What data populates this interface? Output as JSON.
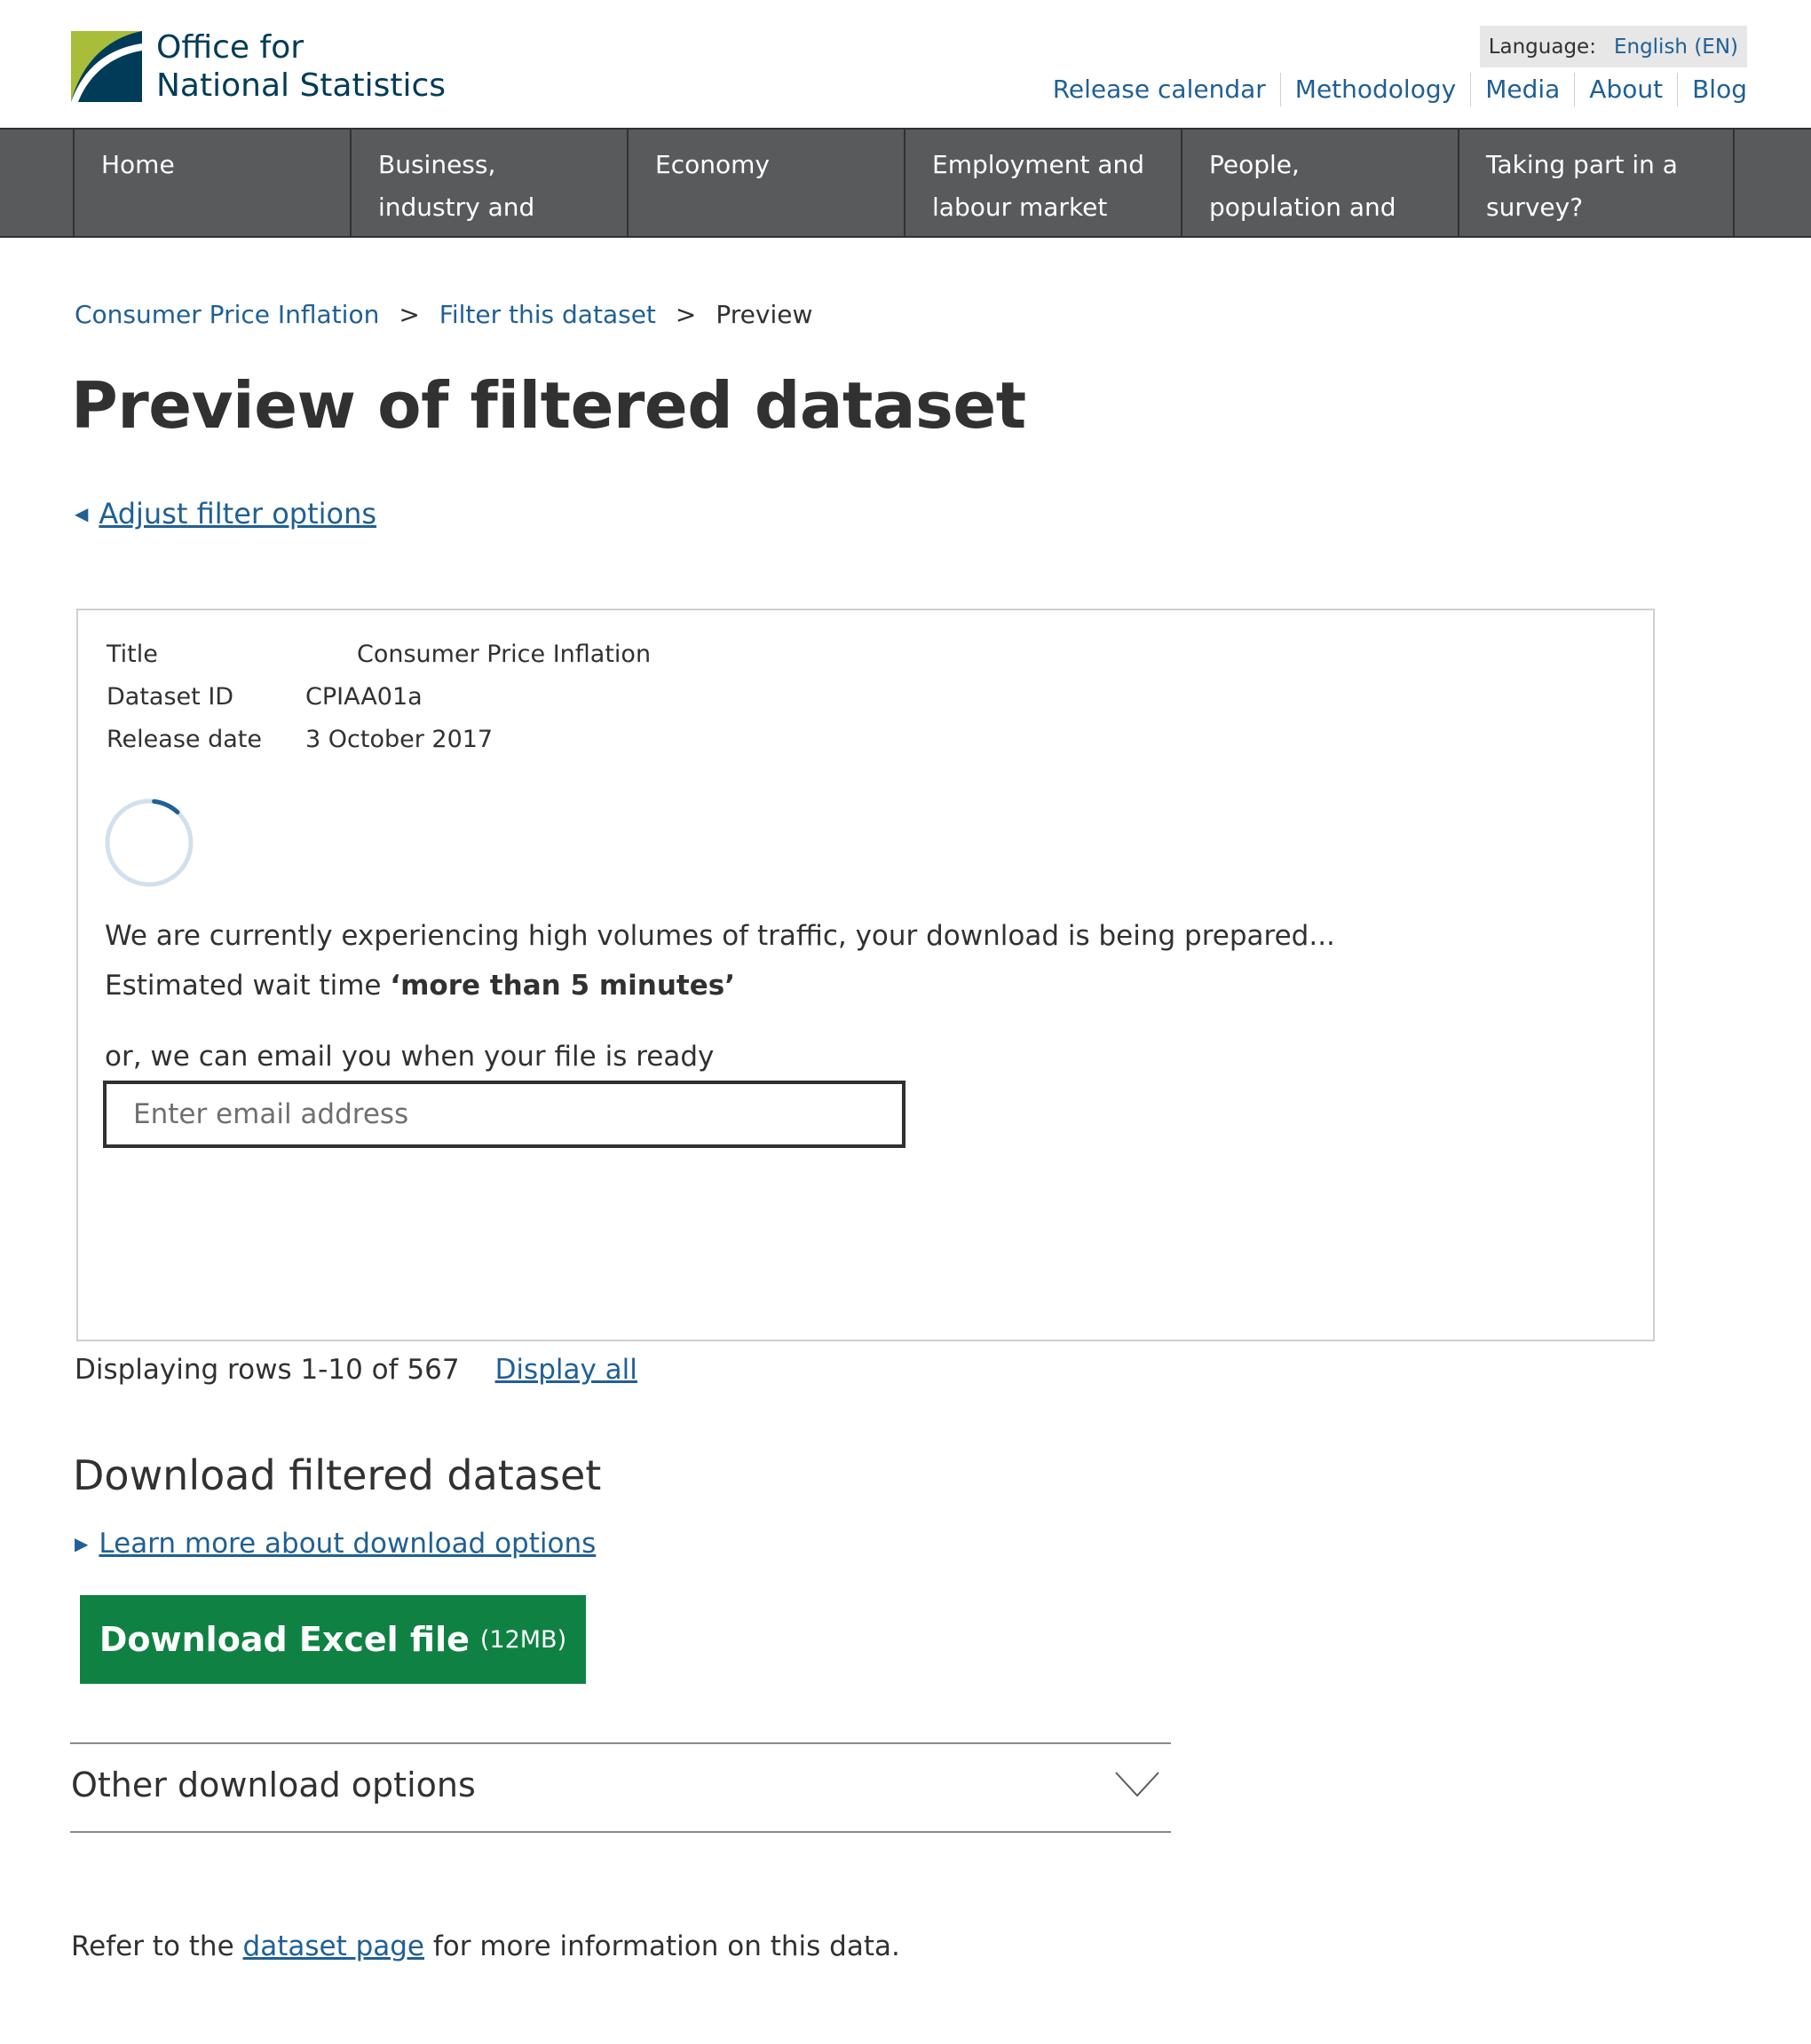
{
  "brand": {
    "name_line1": "Office for",
    "name_line2": "National Statistics",
    "colors": {
      "primary": "#003c57",
      "accent": "#a8bd3a",
      "link": "#206095",
      "nav_bg": "#595a5c",
      "download_green": "#0f8243"
    }
  },
  "header": {
    "language_label": "Language:",
    "language_value": "English (EN)",
    "links": [
      "Release calendar",
      "Methodology",
      "Media",
      "About",
      "Blog"
    ]
  },
  "nav": {
    "items": [
      "Home",
      "Business, industry and trade",
      "Economy",
      "Employment and labour market",
      "People, population and community",
      "Taking part in a survey?"
    ]
  },
  "breadcrumb": {
    "items": [
      "Consumer Price Inflation",
      "Filter this dataset"
    ],
    "current": "Preview",
    "separator": ">"
  },
  "page": {
    "title": "Preview of filtered dataset",
    "back_link": "Adjust filter options"
  },
  "dataset": {
    "title_label": "Title",
    "title_value": "Consumer Price Inflation",
    "id_label": "Dataset ID",
    "id_value": "CPIAA01a",
    "release_label": "Release date",
    "release_value": "3 October 2017"
  },
  "status": {
    "message": "We are currently experiencing high volumes of traffic, your download is being prepared...",
    "wait_prefix": "Estimated wait time",
    "wait_value": "‘more than 5 minutes’",
    "email_prompt": "or, we can email you when your file is ready",
    "email_placeholder": "Enter email address",
    "spinner_progress": 0.06
  },
  "rows": {
    "text": "Displaying rows 1-10 of 567",
    "display_all": "Display all"
  },
  "download": {
    "heading": "Download filtered dataset",
    "learn_more": "Learn more about download options",
    "button_label": "Download Excel file",
    "button_size": "(12MB)",
    "other_options": "Other download options"
  },
  "footer_note": {
    "prefix": "Refer to the",
    "link": "dataset page",
    "suffix": "for more information on this data."
  }
}
